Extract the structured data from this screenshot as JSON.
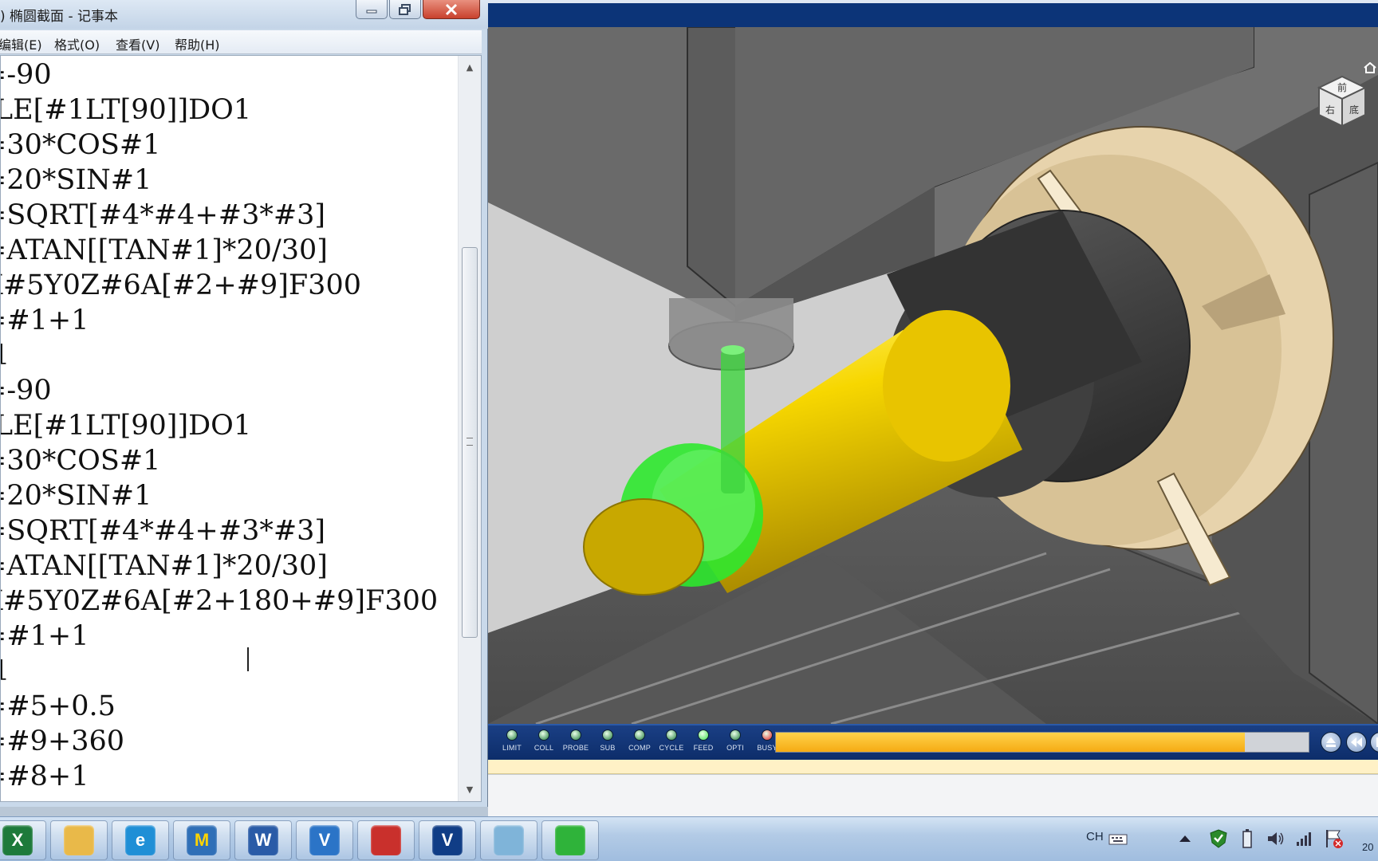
{
  "notepad": {
    "title": ") 椭圆截面 - 记事本",
    "menu": [
      {
        "id": "edit",
        "label": "编辑(E)"
      },
      {
        "id": "format",
        "label": "格式(O)"
      },
      {
        "id": "view",
        "label": "查看(V)"
      },
      {
        "id": "help",
        "label": "帮助(H)"
      }
    ],
    "lines": [
      "=-90",
      "ILE[#1LT[90]]DO1",
      "=30*COS#1",
      "=20*SIN#1",
      "=SQRT[#4*#4+#3*#3]",
      "=ATAN[[TAN#1]*20/30]",
      "X#5Y0Z#6A[#2+#9]F300",
      "=#1+1",
      " 1",
      "=-90",
      "ILE[#1LT[90]]DO1",
      "=30*COS#1",
      "=20*SIN#1",
      "=SQRT[#4*#4+#3*#3]",
      "=ATAN[[TAN#1]*20/30]",
      "X#5Y0Z#6A[#2+180+#9]F300",
      "=#1+1",
      " 1",
      "=#5+0.5",
      "=#9+360",
      "=#8+1"
    ]
  },
  "sim": {
    "viewcube_labels": [
      "前",
      "右",
      "底"
    ],
    "indicators": [
      {
        "id": "limit",
        "label": "LIMIT",
        "color": "#1f7a3a"
      },
      {
        "id": "coll",
        "label": "COLL",
        "color": "#1f7a3a"
      },
      {
        "id": "probe",
        "label": "PROBE",
        "color": "#1f7a3a"
      },
      {
        "id": "sub",
        "label": "SUB",
        "color": "#1f7a3a"
      },
      {
        "id": "comp",
        "label": "COMP",
        "color": "#1f7a3a"
      },
      {
        "id": "cycle",
        "label": "CYCLE",
        "color": "#1f7a3a"
      },
      {
        "id": "feed",
        "label": "FEED",
        "color": "#3fe04c"
      },
      {
        "id": "opti",
        "label": "OPTI",
        "color": "#1f7a3a"
      },
      {
        "id": "busy",
        "label": "BUSY",
        "color": "#e22020"
      }
    ],
    "progress": 0.88,
    "colors": {
      "workpiece": "#f2d000",
      "toolpath": "#2ee82e",
      "chuck": "#e7d3ac",
      "machine": "#4a4a4a",
      "frame": "#0c3478"
    }
  },
  "taskbar": {
    "apps": [
      {
        "id": "excel",
        "icon": "excel-icon",
        "letter": "X"
      },
      {
        "id": "explorer",
        "icon": "folder-icon",
        "letter": ""
      },
      {
        "id": "ie",
        "icon": "ie-icon",
        "letter": "e"
      },
      {
        "id": "vericut-m",
        "icon": "magnifier-app-icon",
        "letter": "M"
      },
      {
        "id": "word",
        "icon": "word-icon",
        "letter": "W"
      },
      {
        "id": "vericut",
        "icon": "vericut-icon",
        "letter": "V"
      },
      {
        "id": "globe",
        "icon": "globe-icon",
        "letter": ""
      },
      {
        "id": "vericut2",
        "icon": "vericut-dark-icon",
        "letter": "V"
      },
      {
        "id": "notepad",
        "icon": "notepad-icon",
        "letter": ""
      },
      {
        "id": "wechat",
        "icon": "wechat-icon",
        "letter": ""
      }
    ],
    "ime": "CH",
    "clock_partial": "20"
  }
}
